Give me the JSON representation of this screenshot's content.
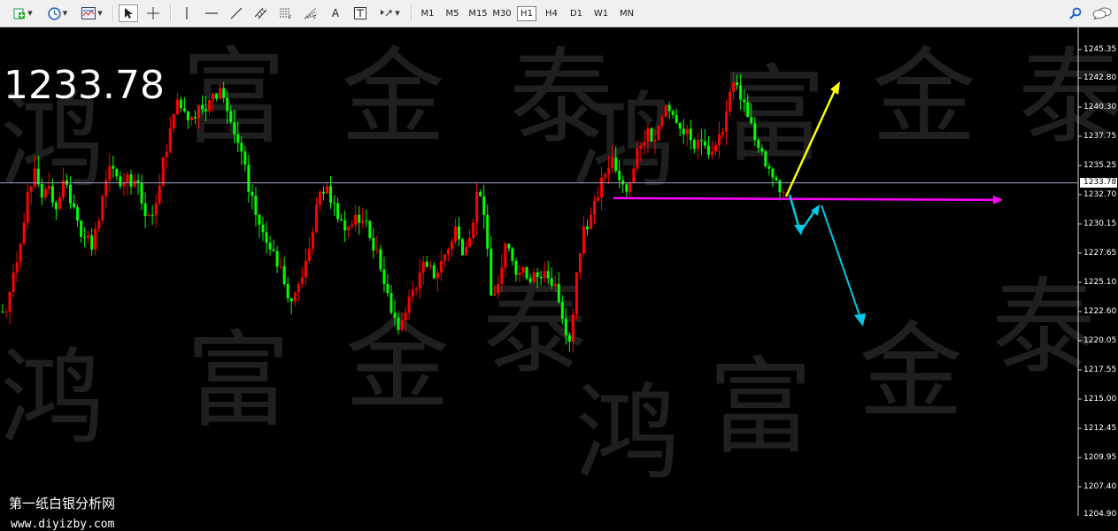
{
  "toolbar": {
    "timeframes": [
      {
        "label": "M1",
        "active": false
      },
      {
        "label": "M5",
        "active": false
      },
      {
        "label": "M15",
        "active": false
      },
      {
        "label": "M30",
        "active": false
      },
      {
        "label": "H1",
        "active": true
      },
      {
        "label": "H4",
        "active": false
      },
      {
        "label": "D1",
        "active": false
      },
      {
        "label": "W1",
        "active": false
      },
      {
        "label": "MN",
        "active": false
      }
    ],
    "text_tool_label": "A",
    "icons": [
      "new-chart-icon",
      "clock-icon",
      "template-icon",
      "cursor-icon",
      "crosshair-icon",
      "vertical-line-icon",
      "horizontal-line-icon",
      "trendline-icon",
      "channel-icon",
      "fibonacci-retracement-icon",
      "fibonacci-fan-icon",
      "text-label-icon",
      "arrows-icon",
      "search-icon",
      "chat-icon"
    ]
  },
  "chart": {
    "current_price_display": "1233.78",
    "current_price_tag": "1233.78",
    "watermark": [
      "鸿",
      "富",
      "金",
      "泰"
    ],
    "brand_name": "第一纸白银分析网",
    "brand_url": "www.diyizby.com",
    "colors": {
      "up": "#ff0000",
      "down": "#00ff00",
      "background": "#000000",
      "grid_line": "#a0a0c8",
      "support_line": "#ff00ff",
      "bull_arrow": "#ffff00",
      "bear_arrow": "#00c8e6"
    },
    "y_axis_labels": [
      "1245.35",
      "1242.80",
      "1240.30",
      "1237.75",
      "1235.25",
      "1232.70",
      "1230.15",
      "1227.65",
      "1225.10",
      "1222.60",
      "1220.05",
      "1217.55",
      "1215.00",
      "1212.45",
      "1209.95",
      "1207.40",
      "1204.90"
    ]
  },
  "chart_data": {
    "type": "candlestick",
    "symbol_timeframe": "H1",
    "y_range": [
      1204.9,
      1246.8
    ],
    "last_price": 1233.78,
    "support_level": 1232.3,
    "close_path": [
      1222.6,
      1226.0,
      1228.5,
      1233.0,
      1235.0,
      1232.5,
      1233.5,
      1231.5,
      1234.0,
      1232.0,
      1230.5,
      1229.0,
      1228.0,
      1230.5,
      1234.0,
      1235.0,
      1233.5,
      1234.5,
      1234.0,
      1232.0,
      1231.0,
      1232.0,
      1236.0,
      1238.5,
      1241.0,
      1240.0,
      1239.5,
      1240.5,
      1240.0,
      1241.5,
      1242.0,
      1240.0,
      1238.0,
      1236.5,
      1233.0,
      1231.0,
      1229.5,
      1228.0,
      1226.5,
      1225.0,
      1223.5,
      1225.0,
      1227.0,
      1229.5,
      1233.0,
      1233.5,
      1232.0,
      1230.5,
      1230.0,
      1231.0,
      1230.5,
      1229.0,
      1228.0,
      1225.0,
      1222.5,
      1221.0,
      1222.5,
      1224.5,
      1226.0,
      1226.5,
      1225.5,
      1227.0,
      1228.0,
      1230.0,
      1227.5,
      1229.0,
      1233.0,
      1231.0,
      1224.0,
      1225.0,
      1228.5,
      1227.0,
      1226.0,
      1225.5,
      1226.0,
      1225.5,
      1225.5,
      1225.0,
      1222.0,
      1220.0,
      1226.0,
      1230.0,
      1231.0,
      1232.5,
      1234.5,
      1236.0,
      1234.0,
      1233.0,
      1235.0,
      1237.0,
      1238.5,
      1237.5,
      1239.5,
      1240.0,
      1239.0,
      1238.0,
      1237.5,
      1237.5,
      1237.0,
      1236.5,
      1238.0,
      1240.0,
      1242.5,
      1241.0,
      1239.5,
      1237.5,
      1236.5,
      1235.0,
      1234.0,
      1233.0
    ]
  }
}
